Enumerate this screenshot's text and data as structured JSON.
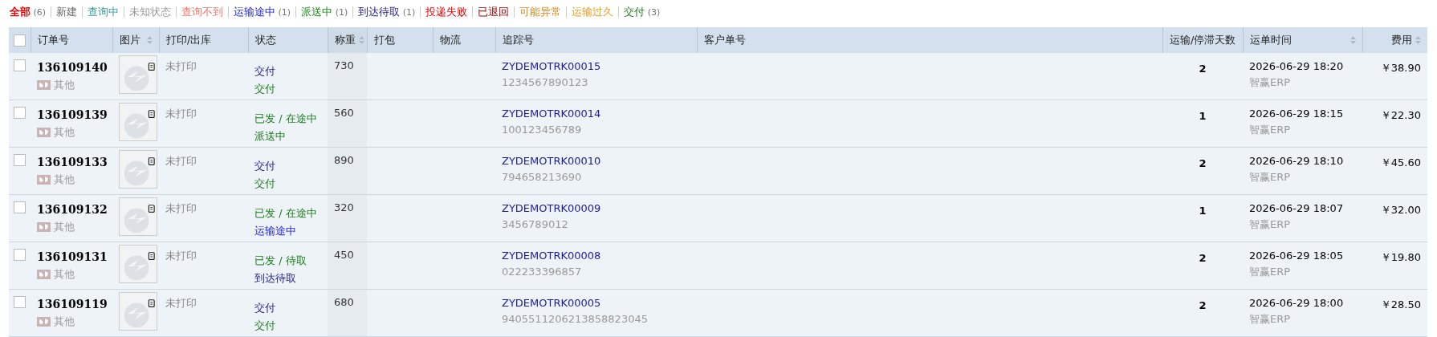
{
  "filters": [
    {
      "label": "全部",
      "count": "(6)",
      "kind": "all",
      "selected": true
    },
    {
      "label": "新建",
      "kind": "new",
      "selected": false
    },
    {
      "label": "查询中",
      "kind": "querying",
      "selected": false
    },
    {
      "label": "未知状态",
      "kind": "unknown",
      "selected": false
    },
    {
      "label": "查询不到",
      "kind": "notfound",
      "selected": false
    },
    {
      "label": "运输途中",
      "count": "(1)",
      "kind": "transit",
      "selected": false
    },
    {
      "label": "派送中",
      "count": "(1)",
      "kind": "delivering",
      "selected": false
    },
    {
      "label": "到达待取",
      "count": "(1)",
      "kind": "pickup",
      "selected": false
    },
    {
      "label": "投递失败",
      "kind": "failed",
      "selected": false
    },
    {
      "label": "已退回",
      "kind": "returned",
      "selected": false
    },
    {
      "label": "可能异常",
      "kind": "exception",
      "selected": false
    },
    {
      "label": "运输过久",
      "kind": "toolong",
      "selected": false
    },
    {
      "label": "交付",
      "count": "(3)",
      "kind": "delivered",
      "selected": false
    }
  ],
  "table": {
    "select_all": {
      "checked": false
    },
    "columns": [
      {
        "label": "订单号",
        "sortable": false
      },
      {
        "label": "图片",
        "sortable": true
      },
      {
        "label": "打印/出库",
        "sortable": false
      },
      {
        "label": "状态",
        "sortable": false
      },
      {
        "label": "称重",
        "sortable": true
      },
      {
        "label": "打包",
        "sortable": false
      },
      {
        "label": "物流",
        "sortable": false
      },
      {
        "label": "追踪号",
        "sortable": false
      },
      {
        "label": "客户单号",
        "sortable": false
      },
      {
        "label": "运输/停滞天数",
        "sortable": false
      },
      {
        "label": "运单时间",
        "sortable": true
      },
      {
        "label": "费用",
        "sortable": true
      }
    ],
    "rows": [
      {
        "checked": false,
        "order": "136109140",
        "source": "其他",
        "print": "未打印",
        "status": [
          {
            "text": "交付",
            "kind": "done"
          },
          {
            "text": "交付",
            "kind": "delivered"
          }
        ],
        "weight": "730",
        "tracking": "ZYDEMOTRK00015",
        "tracking_sub": "1234567890123",
        "days": "2",
        "time": "2026-06-29 18:20",
        "time_sub": "智赢ERP",
        "fee": "￥38.90"
      },
      {
        "checked": false,
        "order": "136109139",
        "source": "其他",
        "print": "未打印",
        "status": [
          {
            "text": "已发 / 在途中",
            "kind": "shipped"
          },
          {
            "text": "派送中",
            "kind": "delivering"
          }
        ],
        "weight": "560",
        "tracking": "ZYDEMOTRK00014",
        "tracking_sub": "100123456789",
        "days": "1",
        "time": "2026-06-29 18:15",
        "time_sub": "智赢ERP",
        "fee": "￥22.30"
      },
      {
        "checked": false,
        "order": "136109133",
        "source": "其他",
        "print": "未打印",
        "status": [
          {
            "text": "交付",
            "kind": "done"
          },
          {
            "text": "交付",
            "kind": "delivered"
          }
        ],
        "weight": "890",
        "tracking": "ZYDEMOTRK00010",
        "tracking_sub": "794658213690",
        "days": "2",
        "time": "2026-06-29 18:10",
        "time_sub": "智赢ERP",
        "fee": "￥45.60"
      },
      {
        "checked": false,
        "order": "136109132",
        "source": "其他",
        "print": "未打印",
        "status": [
          {
            "text": "已发 / 在途中",
            "kind": "shipped"
          },
          {
            "text": "运输途中",
            "kind": "transit"
          }
        ],
        "weight": "320",
        "tracking": "ZYDEMOTRK00009",
        "tracking_sub": "3456789012",
        "days": "1",
        "time": "2026-06-29 18:07",
        "time_sub": "智赢ERP",
        "fee": "￥32.00"
      },
      {
        "checked": false,
        "order": "136109131",
        "source": "其他",
        "print": "未打印",
        "status": [
          {
            "text": "已发 / 待取",
            "kind": "shipped"
          },
          {
            "text": "到达待取",
            "kind": "pickup"
          }
        ],
        "weight": "450",
        "tracking": "ZYDEMOTRK00008",
        "tracking_sub": "022233396857",
        "days": "2",
        "time": "2026-06-29 18:05",
        "time_sub": "智赢ERP",
        "fee": "￥19.80"
      },
      {
        "checked": false,
        "order": "136109119",
        "source": "其他",
        "print": "未打印",
        "status": [
          {
            "text": "交付",
            "kind": "done"
          },
          {
            "text": "交付",
            "kind": "delivered"
          }
        ],
        "weight": "680",
        "tracking": "ZYDEMOTRK00005",
        "tracking_sub": "9405511206213858823045",
        "days": "2",
        "time": "2026-06-29 18:00",
        "time_sub": "智赢ERP",
        "fee": "￥28.50"
      }
    ]
  }
}
